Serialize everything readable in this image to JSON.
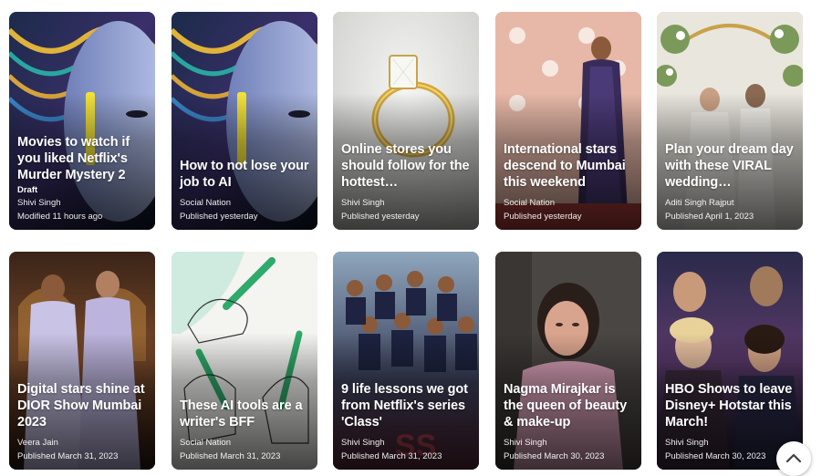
{
  "cards": [
    {
      "title": "Movies to watch if you liked Netflix's Murder Mystery 2",
      "draft": "Draft",
      "author": "Shivi Singh",
      "status": "Modified 11 hours ago",
      "image": "ai-face-art"
    },
    {
      "title": "How to not lose your job to AI",
      "draft": "",
      "author": "Social Nation",
      "status": "Published yesterday",
      "image": "ai-face-art"
    },
    {
      "title": "Online stores you should follow for the hottest…",
      "draft": "",
      "author": "Shivi Singh",
      "status": "Published yesterday",
      "image": "gold-ring"
    },
    {
      "title": "International stars descend to Mumbai this weekend",
      "draft": "",
      "author": "Social Nation",
      "status": "Published yesterday",
      "image": "red-carpet"
    },
    {
      "title": "Plan your dream day with these VIRAL wedding…",
      "draft": "",
      "author": "Aditi Singh Rajput",
      "status": "Published April 1, 2023",
      "image": "wedding"
    },
    {
      "title": "Digital stars shine at DIOR Show Mumbai 2023",
      "draft": "",
      "author": "Veera Jain",
      "status": "Published March 31, 2023",
      "image": "dior-show"
    },
    {
      "title": "These AI tools are a writer's BFF",
      "draft": "",
      "author": "Social Nation",
      "status": "Published March 31, 2023",
      "image": "hands-pens"
    },
    {
      "title": "9 life lessons we got from Netflix's series 'Class'",
      "draft": "",
      "author": "Shivi Singh",
      "status": "Published March 31, 2023",
      "image": "class-poster"
    },
    {
      "title": "Nagma Mirajkar is the queen of beauty & make-up",
      "draft": "",
      "author": "Shivi Singh",
      "status": "Published March 30, 2023",
      "image": "beauty-portrait"
    },
    {
      "title": "HBO Shows to leave Disney+ Hotstar this March!",
      "draft": "",
      "author": "Shivi Singh",
      "status": "Published March 30, 2023",
      "image": "hbo-poster"
    }
  ],
  "scroll_top_icon": "chevron-up-icon"
}
